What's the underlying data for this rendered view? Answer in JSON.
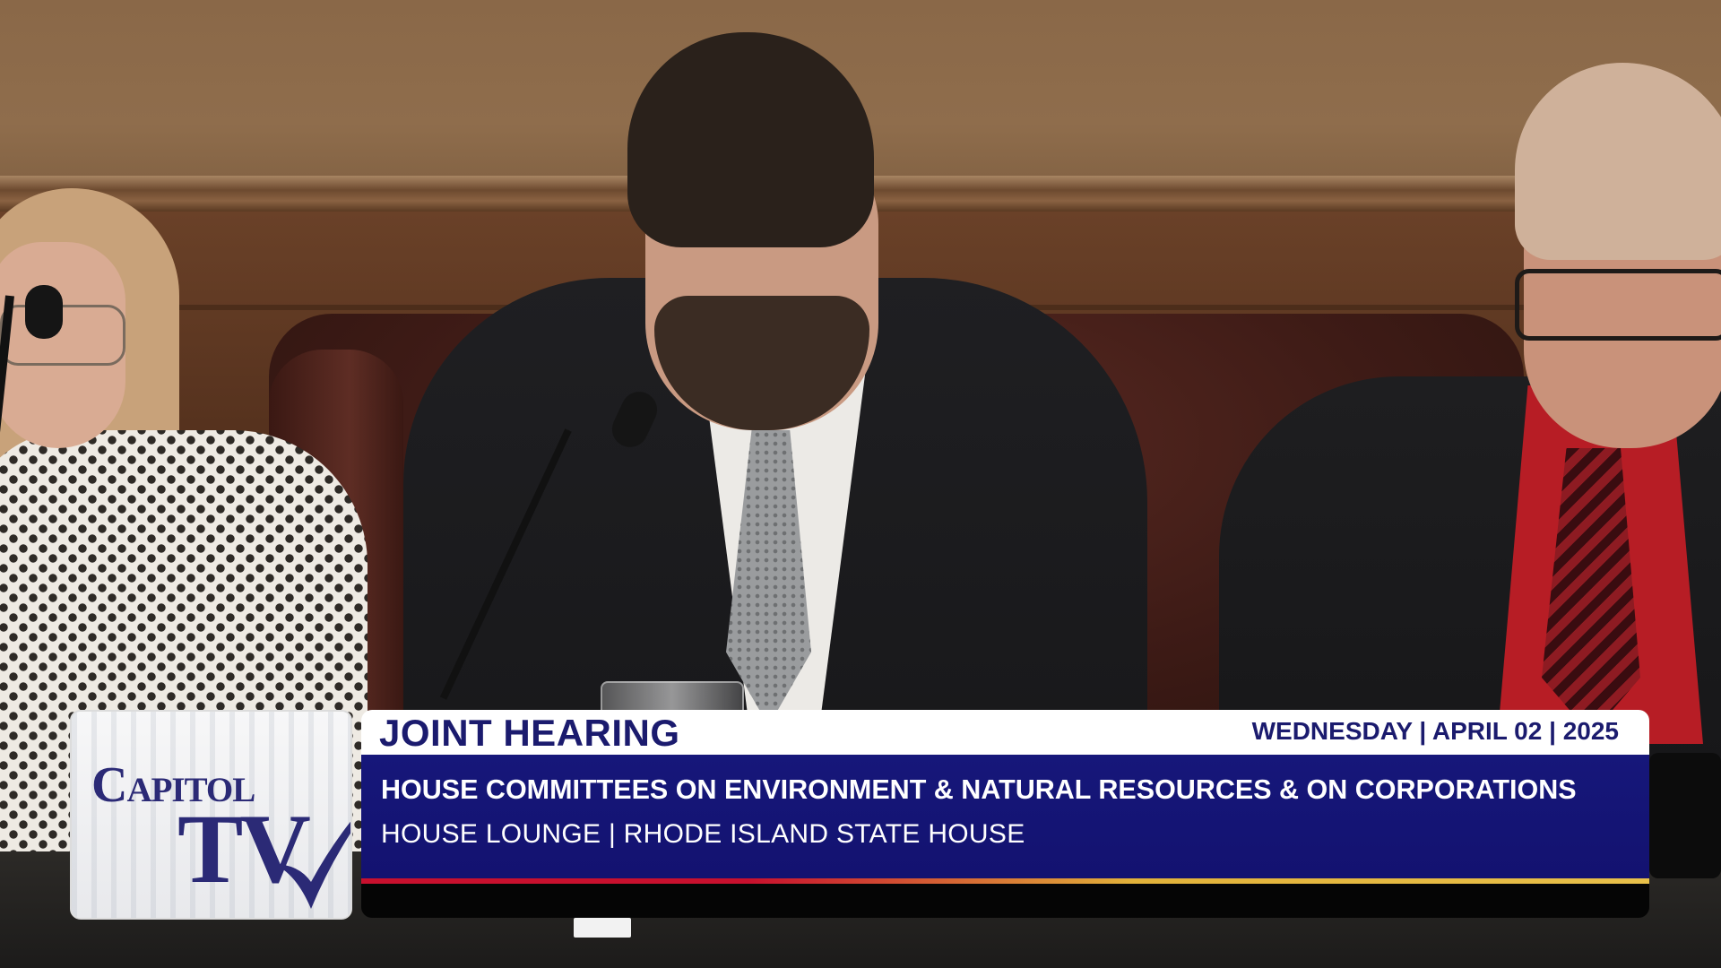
{
  "broadcast": {
    "logo": {
      "line1": "Capitol",
      "line2": "TV",
      "icon": "checkmark-icon",
      "color": "#2b2a76"
    },
    "lower_third": {
      "title": "JOINT HEARING",
      "date": "WEDNESDAY | APRIL 02 | 2025",
      "committee": "HOUSE COMMITTEES ON ENVIRONMENT & NATURAL RESOURCES & ON CORPORATIONS",
      "location": "HOUSE LOUNGE | RHODE ISLAND STATE HOUSE",
      "colors": {
        "primary": "#16177a",
        "title_text": "#1b1b6e",
        "stripe_red": "#c8102e",
        "stripe_gold": "#e8c04a"
      }
    }
  }
}
